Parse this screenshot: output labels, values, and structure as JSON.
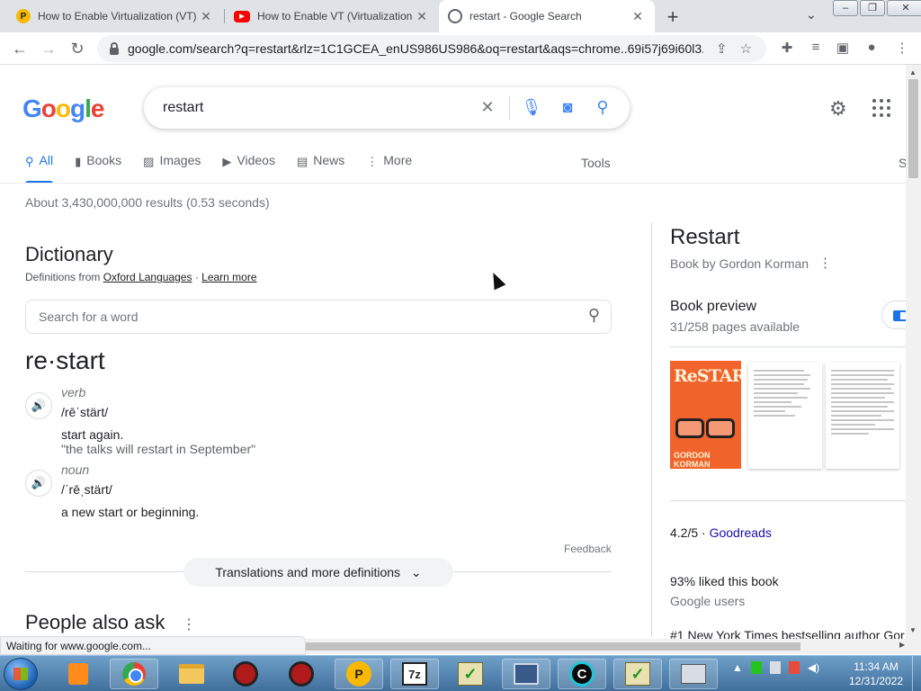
{
  "browser": {
    "tabs": [
      {
        "title": "How to Enable Virtualization (VT)",
        "favicon": "pen-icon",
        "active": false
      },
      {
        "title": "How to Enable VT (Virtualization",
        "favicon": "youtube-icon",
        "active": false
      },
      {
        "title": "restart - Google Search",
        "favicon": "globe-icon",
        "active": true
      }
    ],
    "url": "google.com/search?q=restart&rlz=1C1GCEA_enUS986US986&oq=restart&aqs=chrome..69i57j69i60l3..."
  },
  "search": {
    "query": "restart"
  },
  "nav_tabs": [
    "All",
    "Books",
    "Images",
    "Videos",
    "News",
    "More"
  ],
  "tools_label": "Tools",
  "safesearch_label": "S",
  "result_stats": "About 3,430,000,000 results (0.53 seconds)",
  "dictionary": {
    "title": "Dictionary",
    "source_prefix": "Definitions from",
    "source_link": "Oxford Languages",
    "separator": "·",
    "learn_more": "Learn more",
    "search_placeholder": "Search for a word",
    "word": "re·start",
    "entries": [
      {
        "pos": "verb",
        "phonetic": "/rēˈstärt/",
        "definition": "start again.",
        "example": "\"the talks will restart in September\""
      },
      {
        "pos": "noun",
        "phonetic": "/ˈrēˌstärt/",
        "definition": "a new start or beginning.",
        "example": ""
      }
    ],
    "feedback": "Feedback",
    "more_definitions": "Translations and more definitions"
  },
  "people_also_ask": "People also ask",
  "knowledge_panel": {
    "title": "Restart",
    "subtitle": "Book by Gordon Korman",
    "preview_title": "Book preview",
    "preview_pages": "31/258 pages available",
    "cover_title": "ReSTART",
    "cover_author": "GORDON KORMAN",
    "rating": "4.2/5",
    "rating_sep": "·",
    "rating_source": "Goodreads",
    "liked": "93% liked this book",
    "liked_source": "Google users",
    "bestselling": "#1 New York Times bestselling author Gor"
  },
  "status_text": "Waiting for www.google.com...",
  "taskbar": {
    "time": "11:34 AM",
    "date": "12/31/2022"
  },
  "colors": {
    "google_blue": "#1a73e8",
    "link": "#1a0dab",
    "taskbar": "#4f7fab"
  }
}
